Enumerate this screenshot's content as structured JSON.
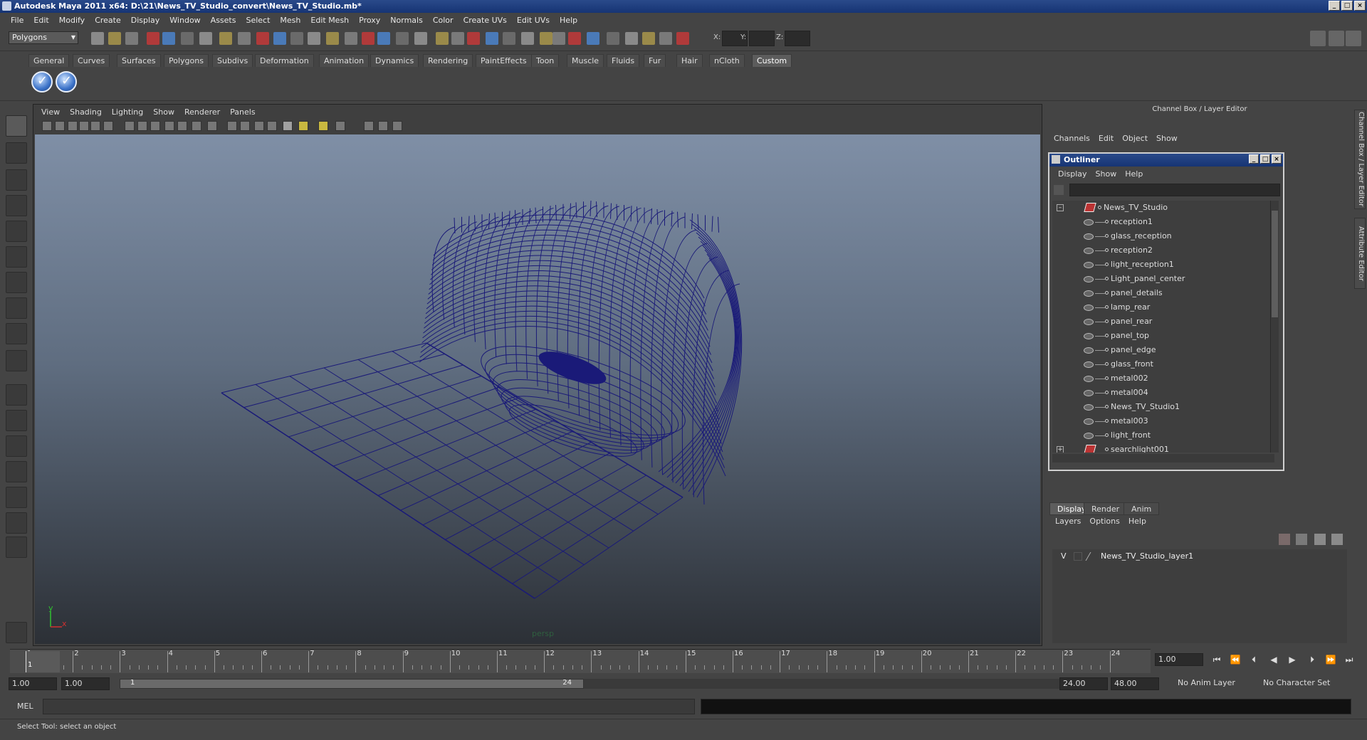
{
  "window": {
    "title": "Autodesk Maya 2011 x64: D:\\21\\News_TV_Studio_convert\\News_TV_Studio.mb*"
  },
  "menubar": [
    "File",
    "Edit",
    "Modify",
    "Create",
    "Display",
    "Window",
    "Assets",
    "Select",
    "Mesh",
    "Edit Mesh",
    "Proxy",
    "Normals",
    "Color",
    "Create UVs",
    "Edit UVs",
    "Help"
  ],
  "statusline": {
    "mode": "Polygons",
    "x_label": "X:",
    "y_label": "Y:",
    "z_label": "Z:"
  },
  "shelf_tabs": [
    "General",
    "Curves",
    "Surfaces",
    "Polygons",
    "Subdivs",
    "Deformation",
    "Animation",
    "Dynamics",
    "Rendering",
    "PaintEffects",
    "Toon",
    "Muscle",
    "Fluids",
    "Fur",
    "Hair",
    "nCloth",
    "Custom"
  ],
  "active_shelf": "Custom",
  "viewport": {
    "menu": [
      "View",
      "Shading",
      "Lighting",
      "Show",
      "Renderer",
      "Panels"
    ],
    "camera_label": "persp",
    "axis_y": "y",
    "axis_x": "x",
    "wire_color": "#1a1a78"
  },
  "channel_box": {
    "header": "Channel Box / Layer Editor",
    "menu": [
      "Channels",
      "Edit",
      "Object",
      "Show"
    ]
  },
  "outliner": {
    "title": "Outliner",
    "menu": [
      "Display",
      "Show",
      "Help"
    ],
    "root": "News_TV_Studio",
    "items": [
      "reception1",
      "glass_reception",
      "reception2",
      "light_reception1",
      "Light_panel_center",
      "panel_details",
      "lamp_rear",
      "panel_rear",
      "panel_top",
      "panel_edge",
      "glass_front",
      "metal002",
      "metal004",
      "News_TV_Studio1",
      "metal003",
      "light_front"
    ],
    "last": "searchlight001"
  },
  "layer_editor": {
    "tabs": [
      "Display",
      "Render",
      "Anim"
    ],
    "active_tab": "Display",
    "menu": [
      "Layers",
      "Options",
      "Help"
    ],
    "layer_visible": "V",
    "layer_name": "News_TV_Studio_layer1"
  },
  "timeline": {
    "ticks": [
      "1",
      "2",
      "3",
      "4",
      "5",
      "6",
      "7",
      "8",
      "9",
      "10",
      "11",
      "12",
      "13",
      "14",
      "15",
      "16",
      "17",
      "18",
      "19",
      "20",
      "21",
      "22",
      "23",
      "24"
    ],
    "current_frame_marker": "1",
    "current_time": "1.00",
    "playback_buttons": [
      "⏮",
      "⏪",
      "⏴",
      "◀",
      "▶",
      "⏵",
      "⏩",
      "⏭"
    ]
  },
  "range": {
    "start": "1.00",
    "anim_start": "1.00",
    "range_start": "1",
    "range_end": "24",
    "anim_end": "24.00",
    "end": "48.00",
    "anim_layer": "No Anim Layer",
    "character_set": "No Character Set"
  },
  "command": {
    "label": "MEL"
  },
  "help_line": "Select Tool: select an object",
  "side_tabs": [
    "Channel Box / Layer Editor",
    "Attribute Editor"
  ]
}
